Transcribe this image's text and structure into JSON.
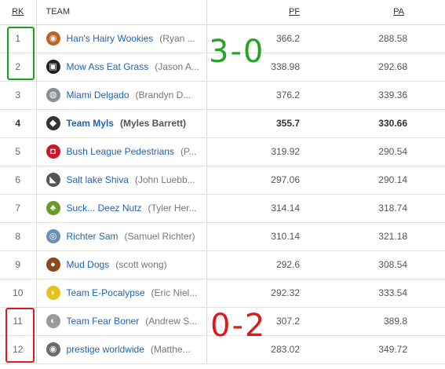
{
  "headers": {
    "rk": "RK",
    "team": "TEAM",
    "pf": "PF",
    "pa": "PA"
  },
  "rows": [
    {
      "rk": "1",
      "team": "Han's Hairy Wookies",
      "owner": "(Ryan ...",
      "pf": "366.2",
      "pa": "288.58",
      "logo_icon": "wookie-icon",
      "logo_color": "#b5652a",
      "glyph": "◉"
    },
    {
      "rk": "2",
      "team": "Mow Ass Eat Grass",
      "owner": "(Jason A...",
      "pf": "338.98",
      "pa": "292.68",
      "logo_icon": "lawnmower-icon",
      "logo_color": "#222222",
      "glyph": "▣"
    },
    {
      "rk": "3",
      "team": "Miami Delgado",
      "owner": "(Brandyn D...",
      "pf": "376.2",
      "pa": "339.36",
      "logo_icon": "cat-icon",
      "logo_color": "#8a8f94",
      "glyph": "◍"
    },
    {
      "rk": "4",
      "team": "Team Myls",
      "owner": "(Myles Barrett)",
      "pf": "355.7",
      "pa": "330.66",
      "logo_icon": "helmet-icon",
      "logo_color": "#333333",
      "glyph": "◆"
    },
    {
      "rk": "5",
      "team": "Bush League Pedestrians",
      "owner": "(P...",
      "pf": "319.92",
      "pa": "290.54",
      "logo_icon": "cup-icon",
      "logo_color": "#c8182a",
      "glyph": "◘"
    },
    {
      "rk": "6",
      "team": "Salt lake Shiva",
      "owner": "(John Luebb...",
      "pf": "297.06",
      "pa": "290.14",
      "logo_icon": "shoe-icon",
      "logo_color": "#555555",
      "glyph": "◣"
    },
    {
      "rk": "7",
      "team": "Suck... Deez Nutz",
      "owner": "(Tyler Her...",
      "pf": "314.14",
      "pa": "318.74",
      "logo_icon": "figure-icon",
      "logo_color": "#6a9a2a",
      "glyph": "♣"
    },
    {
      "rk": "8",
      "team": "Richter Sam",
      "owner": "(Samuel Richter)",
      "pf": "310.14",
      "pa": "321.18",
      "logo_icon": "globe-icon",
      "logo_color": "#6c8fb5",
      "glyph": "◎"
    },
    {
      "rk": "9",
      "team": "Mud Dogs",
      "owner": "(scott wong)",
      "pf": "292.6",
      "pa": "308.54",
      "logo_icon": "monkey-icon",
      "logo_color": "#8a4a1f",
      "glyph": "●"
    },
    {
      "rk": "10",
      "team": "Team E-Pocalypse",
      "owner": "(Eric Niel...",
      "pf": "292.32",
      "pa": "333.54",
      "logo_icon": "helmet-yellow-icon",
      "logo_color": "#e8c21a",
      "glyph": "◗"
    },
    {
      "rk": "11",
      "team": "Team Fear Boner",
      "owner": "(Andrew S...",
      "pf": "307.2",
      "pa": "389.8",
      "logo_icon": "skull-icon",
      "logo_color": "#9a9a9a",
      "glyph": "◐"
    },
    {
      "rk": "12",
      "team": "prestige worldwide",
      "owner": "(Matthe...",
      "pf": "283.02",
      "pa": "349.72",
      "logo_icon": "face-icon",
      "logo_color": "#6a6a6a",
      "glyph": "◉"
    }
  ],
  "highlight_row": "4",
  "annotations": {
    "top_text": "3-0",
    "bottom_text": "0-2",
    "top_color": "#24a324",
    "bottom_color": "#e0191b"
  }
}
